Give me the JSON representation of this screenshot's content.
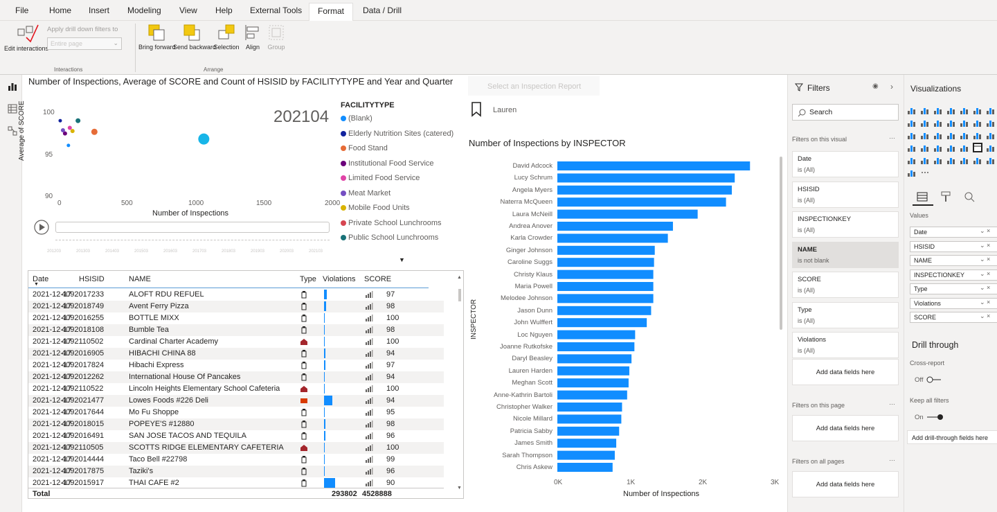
{
  "menu": [
    "File",
    "Home",
    "Insert",
    "Modeling",
    "View",
    "Help",
    "External Tools",
    "Format",
    "Data / Drill"
  ],
  "ribbon": {
    "edit_interactions": "Edit interactions",
    "apply_drill": "Apply drill down filters to",
    "entire_page": "Entire page",
    "bring_forward": "Bring forward",
    "send_backward": "Send backward",
    "selection": "Selection",
    "align": "Align",
    "group": "Group",
    "group_interactions": "Interactions",
    "group_arrange": "Arrange"
  },
  "scatter": {
    "title": "Number of Inspections, Average of SCORE and Count of HSISID by FACILITYTYPE and Year and Quarter",
    "play_label": "202104",
    "ylabel": "Average of SCORE",
    "xlabel": "Number of Inspections",
    "yticks": [
      "100",
      "95",
      "90"
    ],
    "xticks": [
      "0",
      "500",
      "1000",
      "1500",
      "2000"
    ],
    "timeline_ticks": [
      "201203",
      "201303",
      "201403",
      "201503",
      "201603",
      "201703",
      "201803",
      "201903",
      "202003",
      "202103"
    ],
    "legend_title": "FACILITYTYPE",
    "legend": [
      {
        "label": "(Blank)",
        "color": "#118dff"
      },
      {
        "label": "Elderly Nutrition Sites (catered)",
        "color": "#12239e"
      },
      {
        "label": "Food Stand",
        "color": "#e66c37"
      },
      {
        "label": "Institutional Food Service",
        "color": "#6b007b"
      },
      {
        "label": "Limited Food Service",
        "color": "#e044a7"
      },
      {
        "label": "Meat Market",
        "color": "#744ec2"
      },
      {
        "label": "Mobile Food Units",
        "color": "#d9b300"
      },
      {
        "label": "Private School Lunchrooms",
        "color": "#d64550"
      },
      {
        "label": "Public School Lunchrooms",
        "color": "#197278"
      }
    ]
  },
  "slicer": {
    "placeholder": "Select an Inspection Report",
    "bookmark_label": "Lauren"
  },
  "table": {
    "headers": [
      "Date",
      "HSISID",
      "NAME",
      "Type",
      "Violations",
      "SCORE"
    ],
    "rows": [
      [
        "2021-12-17",
        "4092017233",
        "ALOFT RDU REFUEL",
        "97"
      ],
      [
        "2021-12-17",
        "4092018749",
        "Avent Ferry Pizza",
        "98"
      ],
      [
        "2021-12-17",
        "4092016255",
        "BOTTLE MIXX",
        "100"
      ],
      [
        "2021-12-17",
        "4092018108",
        "Bumble Tea",
        "98"
      ],
      [
        "2021-12-17",
        "4092110502",
        "Cardinal Charter Academy",
        "100"
      ],
      [
        "2021-12-17",
        "4092016905",
        "HIBACHI CHINA 88",
        "94"
      ],
      [
        "2021-12-17",
        "4092017824",
        "Hibachi Express",
        "97"
      ],
      [
        "2021-12-17",
        "4092012262",
        "International House Of Pancakes",
        "94"
      ],
      [
        "2021-12-17",
        "4092110522",
        "Lincoln Heights Elementary School Cafeteria",
        "100"
      ],
      [
        "2021-12-17",
        "4092021477",
        "Lowes Foods #226 Deli",
        "94"
      ],
      [
        "2021-12-17",
        "4092017644",
        "Mo Fu Shoppe",
        "95"
      ],
      [
        "2021-12-17",
        "4092018015",
        "POPEYE'S #12880",
        "98"
      ],
      [
        "2021-12-17",
        "4092016491",
        "SAN JOSE TACOS AND TEQUILA",
        "96"
      ],
      [
        "2021-12-17",
        "4092110505",
        "SCOTTS RIDGE ELEMENTARY CAFETERIA",
        "100"
      ],
      [
        "2021-12-17",
        "4092014444",
        "Taco Bell #22798",
        "99"
      ],
      [
        "2021-12-17",
        "4092017875",
        "Taziki's",
        "96"
      ],
      [
        "2021-12-17",
        "4092015917",
        "THAI CAFE #2",
        "90"
      ]
    ],
    "total_label": "Total",
    "total_violations": "293802",
    "total_score": "4528888"
  },
  "bar": {
    "title": "Number of Inspections by INSPECTOR",
    "ylabel": "INSPECTOR",
    "xlabel": "Number of Inspections",
    "xticks": [
      "0K",
      "1K",
      "2K",
      "3K"
    ]
  },
  "chart_data": [
    {
      "type": "bar",
      "title": "Number of Inspections by INSPECTOR",
      "xlabel": "Number of Inspections",
      "ylabel": "INSPECTOR",
      "xlim": [
        0,
        3000
      ],
      "categories": [
        "David Adcock",
        "Lucy Schrum",
        "Angela Myers",
        "Naterra McQueen",
        "Laura McNeill",
        "Andrea Anover",
        "Karla Crowder",
        "Ginger Johnson",
        "Caroline Suggs",
        "Christy Klaus",
        "Maria Powell",
        "Melodee Johnson",
        "Jason Dunn",
        "John Wulffert",
        "Loc Nguyen",
        "Joanne Rutkofske",
        "Daryl Beasley",
        "Lauren Harden",
        "Meghan Scott",
        "Anne-Kathrin Bartoli",
        "Christopher Walker",
        "Nicole Millard",
        "Patricia Sabby",
        "James Smith",
        "Sarah Thompson",
        "Chris Askew"
      ],
      "values": [
        2650,
        2440,
        2400,
        2320,
        1930,
        1590,
        1520,
        1340,
        1330,
        1320,
        1320,
        1320,
        1290,
        1230,
        1070,
        1060,
        1020,
        990,
        980,
        960,
        890,
        880,
        850,
        810,
        790,
        760
      ],
      "color": "#118dff"
    },
    {
      "type": "scatter",
      "title": "Number of Inspections, Average of SCORE and Count of HSISID by FACILITYTYPE and Year and Quarter",
      "xlabel": "Number of Inspections",
      "ylabel": "Average of SCORE",
      "xlim": [
        0,
        2000
      ],
      "ylim": [
        90,
        100
      ],
      "points": [
        {
          "series": "(Blank)",
          "x": 1060,
          "y": 96.9,
          "size": 16,
          "color": "#17b5e8"
        },
        {
          "series": "Elderly Nutrition Sites (catered)",
          "x": 10,
          "y": 99.2,
          "size": 5,
          "color": "#12239e"
        },
        {
          "series": "Food Stand",
          "x": 260,
          "y": 97.8,
          "size": 9,
          "color": "#e66c37"
        },
        {
          "series": "Institutional Food Service",
          "x": 45,
          "y": 97.6,
          "size": 6,
          "color": "#6b007b"
        },
        {
          "series": "Limited Food Service",
          "x": 80,
          "y": 98.3,
          "size": 6,
          "color": "#e044a7"
        },
        {
          "series": "Meat Market",
          "x": 30,
          "y": 98.0,
          "size": 6,
          "color": "#744ec2"
        },
        {
          "series": "Mobile Food Units",
          "x": 100,
          "y": 97.9,
          "size": 6,
          "color": "#d9b300"
        },
        {
          "series": "Private School Lunchrooms",
          "x": 70,
          "y": 96.1,
          "size": 5,
          "color": "#118dff"
        },
        {
          "series": "Public School Lunchrooms",
          "x": 140,
          "y": 99.2,
          "size": 7,
          "color": "#197278"
        }
      ]
    }
  ],
  "filters": {
    "title": "Filters",
    "search": "Search",
    "on_visual": "Filters on this visual",
    "cards": [
      {
        "name": "Date",
        "value": "is (All)"
      },
      {
        "name": "HSISID",
        "value": "is (All)"
      },
      {
        "name": "INSPECTIONKEY",
        "value": "is (All)"
      },
      {
        "name": "NAME",
        "value": "is not blank"
      },
      {
        "name": "SCORE",
        "value": "is (All)"
      },
      {
        "name": "Type",
        "value": "is (All)"
      },
      {
        "name": "Violations",
        "value": "is (All)"
      }
    ],
    "add_fields": "Add data fields here",
    "on_page": "Filters on this page",
    "on_all": "Filters on all pages"
  },
  "viz": {
    "title": "Visualizations",
    "values_label": "Values",
    "fields": [
      "Date",
      "HSISID",
      "NAME",
      "INSPECTIONKEY",
      "Type",
      "Violations",
      "SCORE"
    ],
    "drill_through": "Drill through",
    "cross_report": "Cross-report",
    "off": "Off",
    "keep_all": "Keep all filters",
    "on": "On",
    "add_drill": "Add drill-through fields here"
  }
}
